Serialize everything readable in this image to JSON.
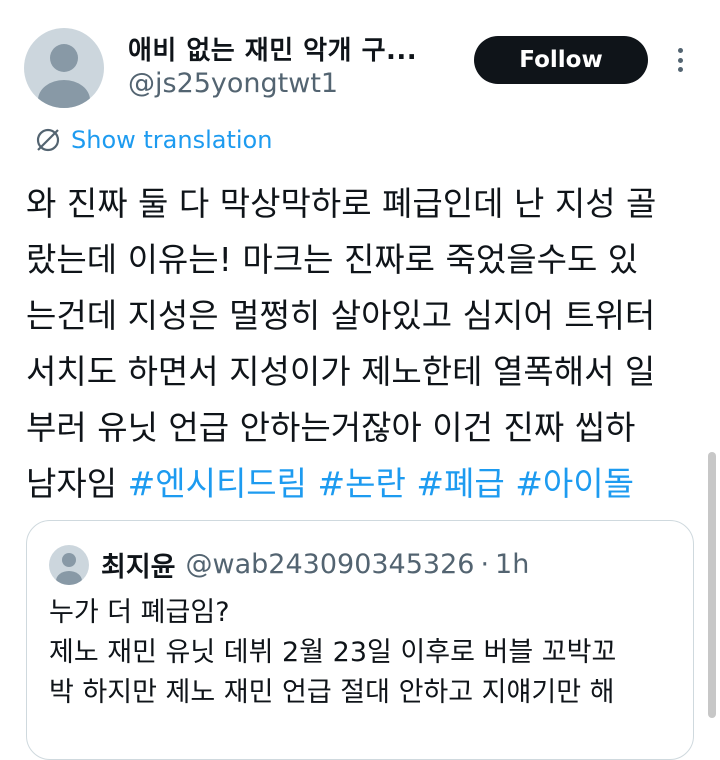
{
  "tweet": {
    "display_name": "애비 없는 재민 악개 구...",
    "handle": "@js25yongtwt1",
    "follow_label": "Follow",
    "translate_label": "Show translation",
    "body_lines": [
      "와 진짜 둘 다 막상막하로 폐급인데 난 지성 골",
      "랐는데 이유는! 마크는 진짜로 죽었을수도 있",
      "는건데 지성은 멀쩡히 살아있고 심지어 트위터",
      "서치도 하면서 지성이가 제노한테 열폭해서 일",
      "부러 유닛 언급 안하는거잖아 이건 진짜 씹하",
      "남자임 "
    ],
    "hashtags": [
      "#엔시티드림",
      "#논란",
      "#폐급",
      "#아이돌"
    ]
  },
  "quoted_tweet": {
    "name": "최지윤",
    "handle": "@wab243090345326",
    "separator": "·",
    "time": "1h",
    "lines": [
      "누가 더 폐급임?",
      "제노 재민 유닛 데뷔 2월 23일 이후로 버블 꼬박꼬",
      "박 하지만 제노 재민 언급 절대 안하고 지얘기만 해"
    ]
  },
  "colors": {
    "accent": "#1d9bf0",
    "text": "#0f1419",
    "muted": "#536471",
    "button": "#0f1419"
  }
}
